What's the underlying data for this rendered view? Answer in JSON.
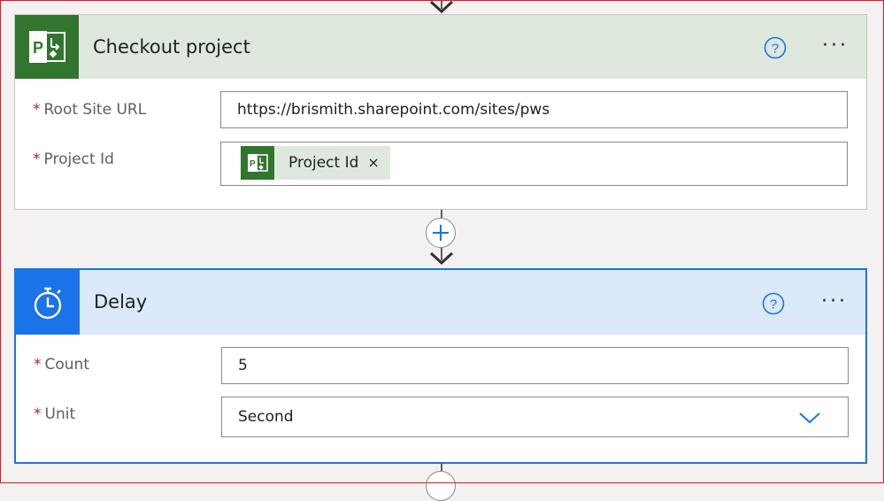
{
  "checkout": {
    "title": "Checkout project",
    "fields": [
      {
        "label": "Root Site URL",
        "required": true,
        "value": "https://brismith.sharepoint.com/sites/pws"
      },
      {
        "label": "Project Id",
        "required": true,
        "token": {
          "label": "Project Id",
          "icon": "project-icon",
          "close": "×"
        }
      }
    ],
    "help_icon": "help-circle-icon",
    "more_label": "···"
  },
  "delay": {
    "title": "Delay",
    "fields": [
      {
        "label": "Count",
        "required": true,
        "value": "5"
      },
      {
        "label": "Unit",
        "required": true,
        "value": "Second",
        "dropdown_icon": "chevron-down-icon"
      }
    ],
    "help_icon": "help-circle-icon",
    "more_label": "···"
  },
  "required_marker": "*",
  "colors": {
    "project_green": "#31752f",
    "accent_blue": "#1a73e8",
    "required_red": "#a4262c",
    "frame_red": "#e81123"
  },
  "add_step_icon": "plus-icon"
}
